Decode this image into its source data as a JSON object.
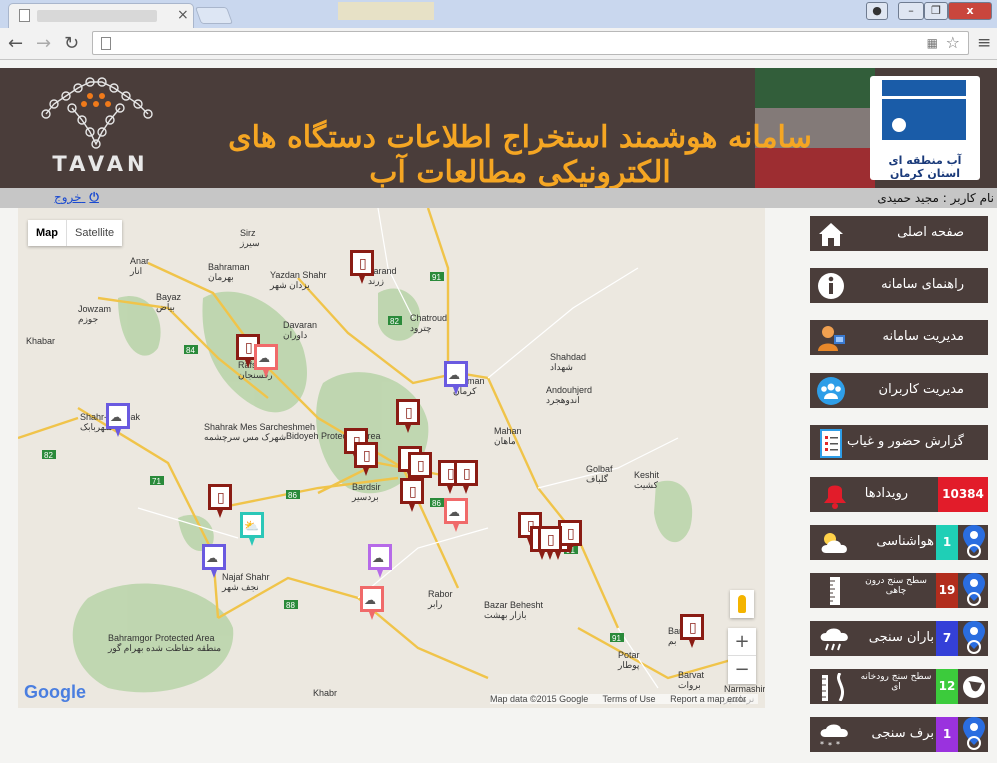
{
  "browser": {
    "tab_close": "×",
    "back": "←",
    "forward": "→",
    "reload": "↻",
    "win_min": "–",
    "win_max": "❐",
    "win_close": "x",
    "menu": "≡"
  },
  "header": {
    "title": "سامانه هوشمند استخراج اطلاعات دستگاه های الکترونیکی مطالعات آب",
    "org_caption": "آب منطقه ای استان کرمان",
    "brand": "TAVAN"
  },
  "userbar": {
    "username": "نام کاربر : مجید حمیدی",
    "logout": "خروج"
  },
  "map": {
    "type_map": "Map",
    "type_satellite": "Satellite",
    "zoom_in": "+",
    "zoom_out": "−",
    "google": "Google",
    "attribution": [
      "Map data ©2015 Google",
      "Terms of Use",
      "Report a map error"
    ],
    "places": [
      {
        "en": "Sirz",
        "fa": "سیرز"
      },
      {
        "en": "Anar",
        "fa": "انار"
      },
      {
        "en": "Bahraman",
        "fa": "بهرمان"
      },
      {
        "en": "Yazdan Shahr",
        "fa": "یزدان شهر"
      },
      {
        "en": "Zarand",
        "fa": "زرند"
      },
      {
        "en": "Bayaz",
        "fa": "بیاض"
      },
      {
        "en": "Jowzam",
        "fa": "جوزم"
      },
      {
        "en": "Khabar",
        "fa": ""
      },
      {
        "en": "Davaran",
        "fa": "داوران"
      },
      {
        "en": "Chatroud",
        "fa": "چترود"
      },
      {
        "en": "Rafsanjan",
        "fa": "رفسنجان"
      },
      {
        "en": "Kerman",
        "fa": "کرمان"
      },
      {
        "en": "Shahdad",
        "fa": "شهداد"
      },
      {
        "en": "Andouhjerd",
        "fa": "اندوهجرد"
      },
      {
        "en": "Shahr-e Babak",
        "fa": "شهربابک"
      },
      {
        "en": "Shahrak Mes Sarcheshmeh",
        "fa": "شهرک مس سرچشمه"
      },
      {
        "en": "Bidoyeh Protected Area",
        "fa": ""
      },
      {
        "en": "Mahan",
        "fa": "ماهان"
      },
      {
        "en": "Golbaf",
        "fa": "گلباف"
      },
      {
        "en": "Keshit",
        "fa": "کشیت"
      },
      {
        "en": "Bardsir",
        "fa": "بردسیر"
      },
      {
        "en": "Najaf Shahr",
        "fa": "نجف شهر"
      },
      {
        "en": "Rabor",
        "fa": "رابر"
      },
      {
        "en": "Bazar Behesht",
        "fa": "بازار بهشت"
      },
      {
        "en": "Potar",
        "fa": "پوطار"
      },
      {
        "en": "Bahramgor Protected Area",
        "fa": "منطقه حفاظت شده بهرام گور"
      },
      {
        "en": "Khabr",
        "fa": ""
      },
      {
        "en": "Bam",
        "fa": "بم"
      },
      {
        "en": "Narmashir",
        "fa": "نرماشیر"
      },
      {
        "en": "Barvat",
        "fa": "بروات"
      }
    ],
    "roads": [
      "91",
      "84",
      "82",
      "71",
      "86",
      "88"
    ]
  },
  "menu": [
    {
      "label": "صفحه اصلی",
      "icon": "home-icon"
    },
    {
      "label": "راهنمای سامانه",
      "icon": "info-icon"
    },
    {
      "label": "مدیریت سامانه",
      "icon": "admin-icon"
    },
    {
      "label": "مدیریت کاربران",
      "icon": "users-icon"
    },
    {
      "label": "گزارش حضور و غیاب",
      "icon": "report-icon"
    }
  ],
  "stats": [
    {
      "label": "رویدادها",
      "count": "10384",
      "count_color": "#e21c2a",
      "icon": "alarm-bell-icon"
    },
    {
      "label": "هواشناسی",
      "count": "1",
      "count_color": "#1fcfb6",
      "icon": "weather-icon"
    },
    {
      "label": "سطح سنج درون چاهی",
      "count": "19",
      "count_color": "#b22d1d",
      "icon": "well-gauge-icon"
    },
    {
      "label": "باران سنجی",
      "count": "7",
      "count_color": "#3440d8",
      "icon": "rain-gauge-icon"
    },
    {
      "label": "سطح سنج رودخانه ای",
      "count": "12",
      "count_color": "#3ccb3c",
      "icon": "river-gauge-icon"
    },
    {
      "label": "برف سنجی",
      "count": "1",
      "count_color": "#9a32de",
      "icon": "snow-gauge-icon"
    }
  ]
}
